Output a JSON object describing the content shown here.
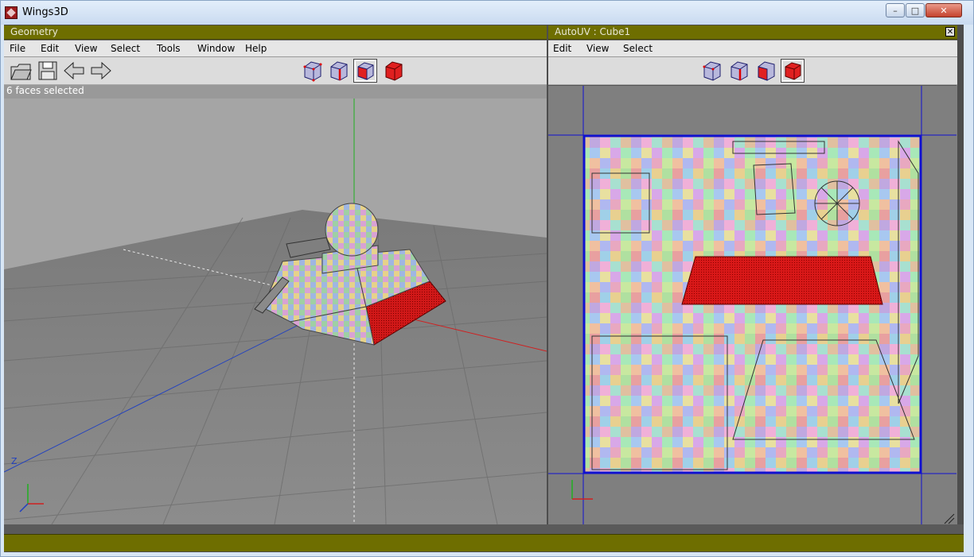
{
  "window": {
    "title": "Wings3D",
    "minimize_label": "–",
    "maximize_label": "□",
    "close_label": "✕"
  },
  "geometry": {
    "title": "Geometry",
    "menu": [
      "File",
      "Edit",
      "View",
      "Select",
      "Tools",
      "Window",
      "Help"
    ],
    "status": "6 faces selected",
    "selection_modes": [
      {
        "icon": "vertex-mode-icon",
        "selected": false
      },
      {
        "icon": "edge-mode-icon",
        "selected": false
      },
      {
        "icon": "face-mode-icon",
        "selected": true
      },
      {
        "icon": "body-mode-icon",
        "selected": false
      }
    ],
    "axis_label": "Z"
  },
  "autouv": {
    "title": "AutoUV : Cube1",
    "close_label": "✕",
    "menu": [
      "Edit",
      "View",
      "Select"
    ],
    "selection_modes": [
      {
        "icon": "vertex-mode-icon",
        "selected": false
      },
      {
        "icon": "edge-mode-icon",
        "selected": false
      },
      {
        "icon": "face-mode-icon",
        "selected": false
      },
      {
        "icon": "body-mode-icon",
        "selected": true
      }
    ]
  },
  "colors": {
    "panel_title_bg": "#6e6e00",
    "selection_red": "#e02020",
    "axis_x": "#d02020",
    "axis_y": "#20b020",
    "axis_z": "#2040c0",
    "uv_border": "#1010d0"
  }
}
